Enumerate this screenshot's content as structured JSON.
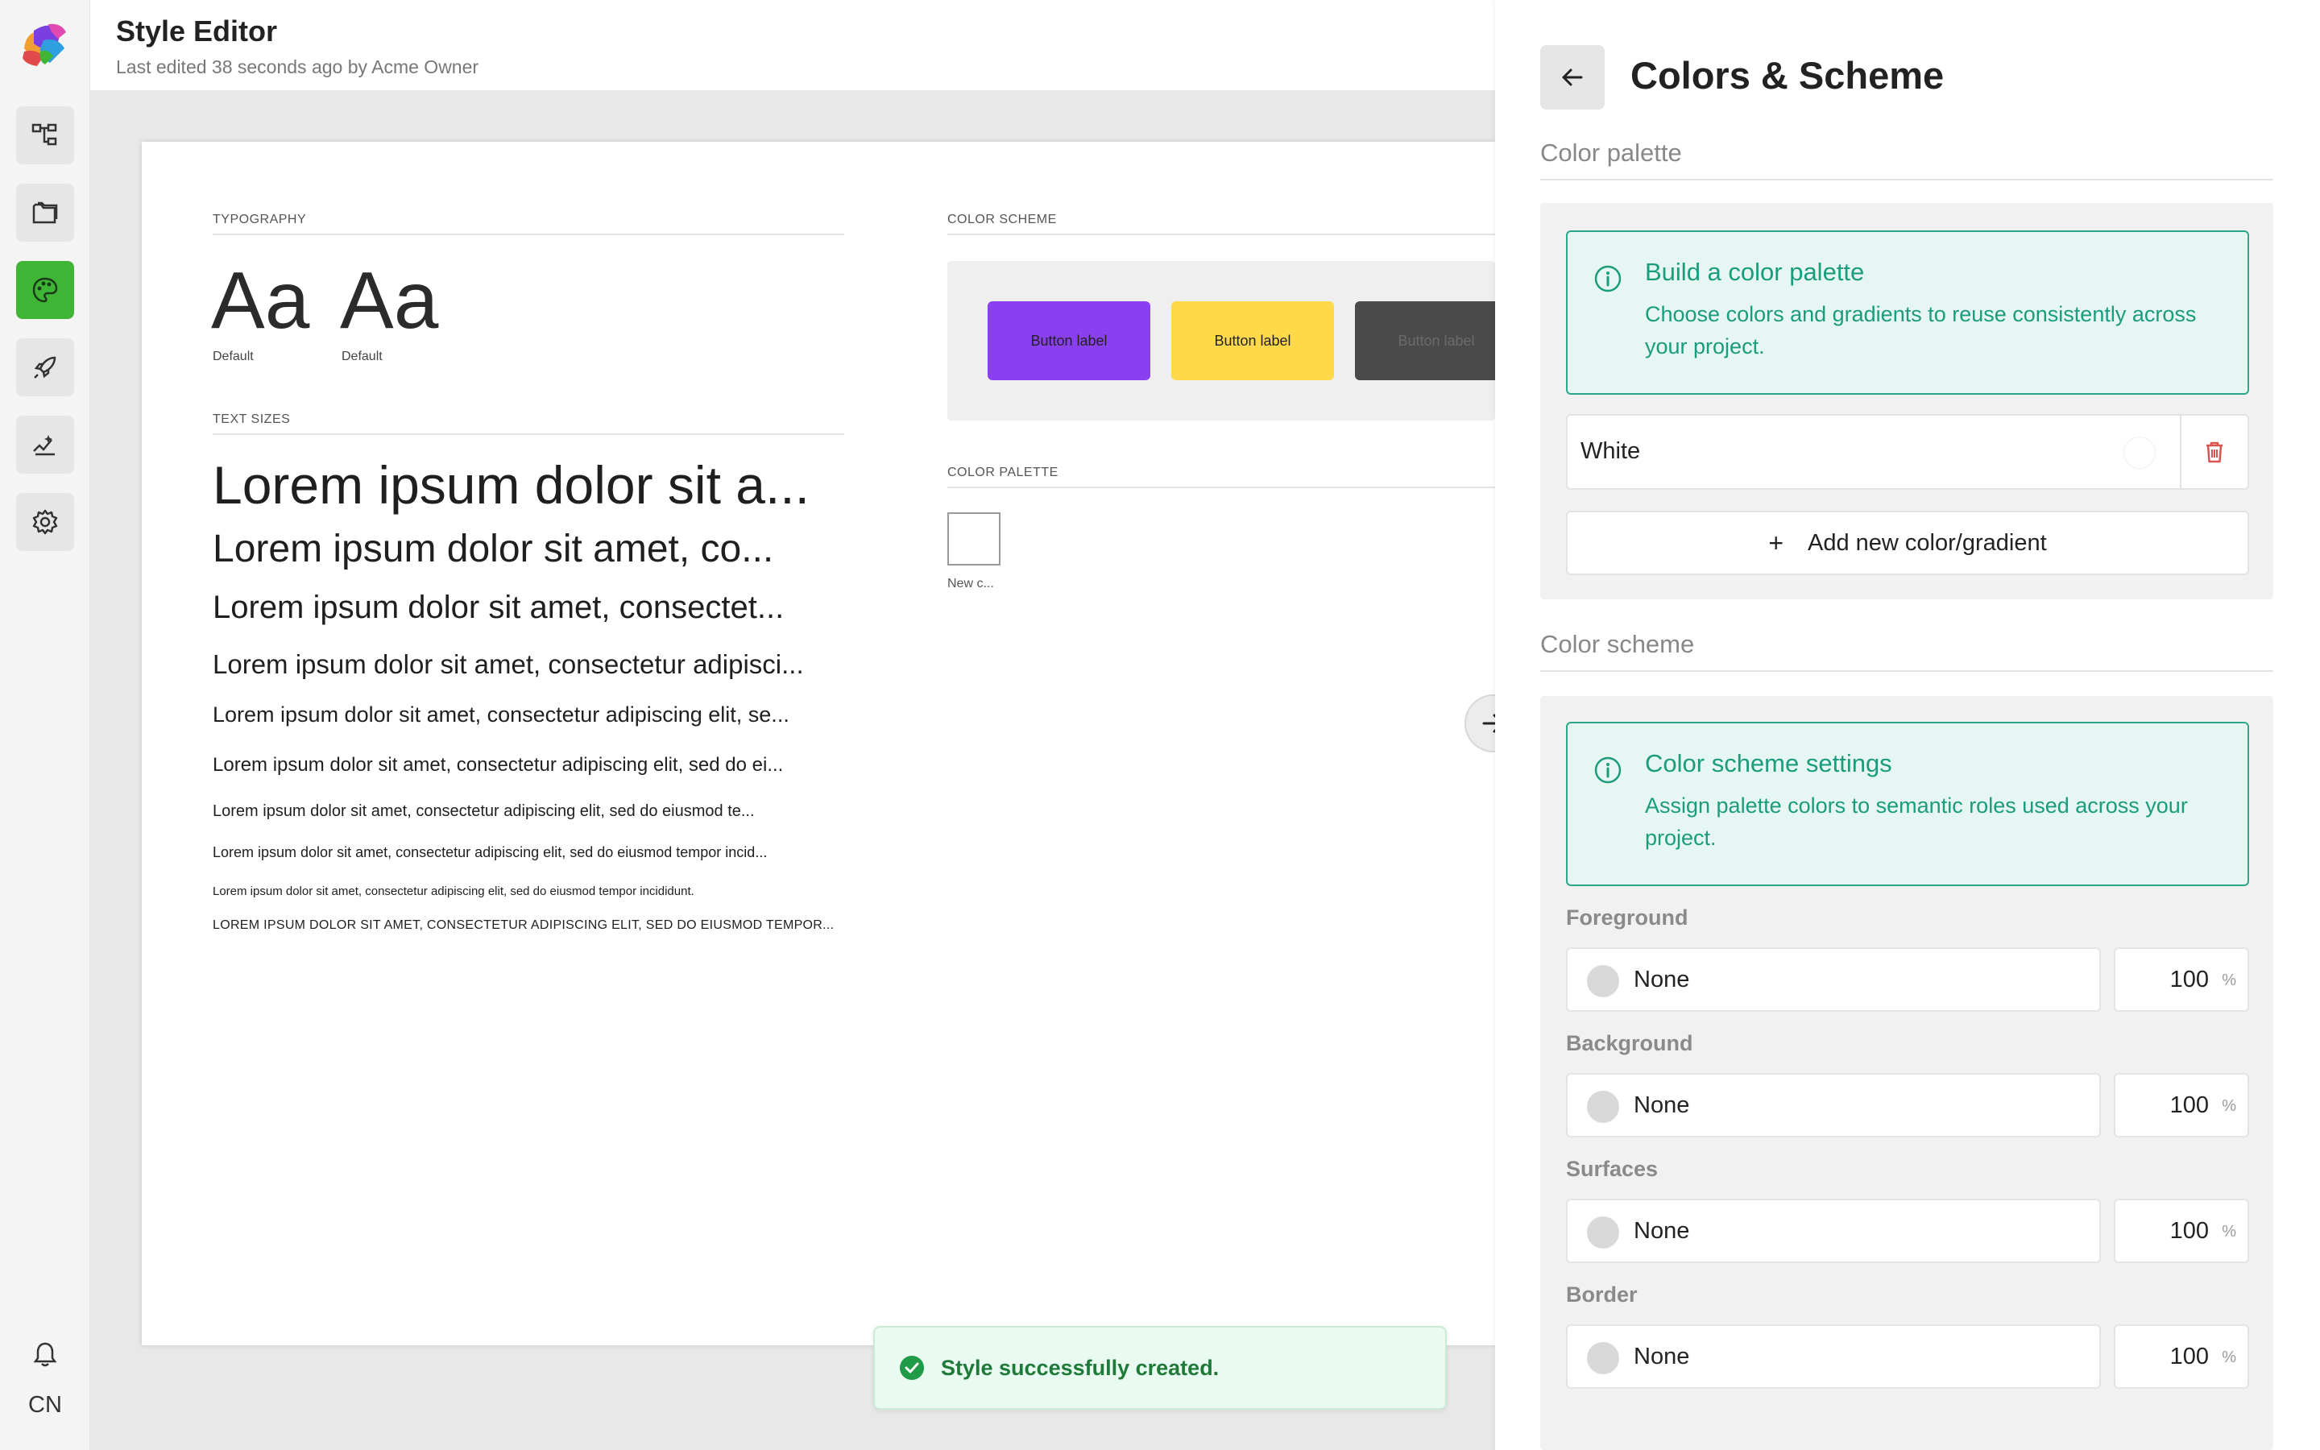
{
  "header": {
    "title": "Style Editor",
    "subtitle": "Last edited 38 seconds ago by Acme Owner"
  },
  "sidebar": {
    "items": [
      {
        "icon": "sitemap-icon"
      },
      {
        "icon": "pages-icon"
      },
      {
        "icon": "palette-icon",
        "active": true
      },
      {
        "icon": "rocket-icon"
      },
      {
        "icon": "analytics-icon"
      },
      {
        "icon": "gear-icon"
      }
    ],
    "user_initials": "CN"
  },
  "canvas": {
    "typography_label": "TYPOGRAPHY",
    "font_samples": [
      {
        "glyph": "Aa",
        "label": "Default"
      },
      {
        "glyph": "Aa",
        "label": "Default"
      }
    ],
    "text_sizes_label": "TEXT SIZES",
    "text_samples": [
      "Lorem ipsum dolor sit a...",
      "Lorem ipsum dolor sit amet, co...",
      "Lorem ipsum dolor sit amet, consectet...",
      "Lorem ipsum dolor sit amet, consectetur adipisci...",
      "Lorem ipsum dolor sit amet, consectetur adipiscing elit, se...",
      "Lorem ipsum dolor sit amet, consectetur adipiscing elit, sed do ei...",
      "Lorem ipsum dolor sit amet, consectetur adipiscing elit, sed do eiusmod te...",
      "Lorem ipsum dolor sit amet, consectetur adipiscing elit, sed do eiusmod tempor incid...",
      "Lorem ipsum dolor sit amet, consectetur adipiscing elit, sed do eiusmod tempor incididunt.",
      "LOREM IPSUM DOLOR SIT AMET, CONSECTETUR ADIPISCING ELIT, SED DO EIUSMOD TEMPOR..."
    ],
    "color_scheme_label": "COLOR SCHEME",
    "scheme_buttons": [
      {
        "label": "Button label",
        "bg": "#8a3ff0",
        "fg": "#222222"
      },
      {
        "label": "Button label",
        "bg": "#ffd94a",
        "fg": "#222222"
      },
      {
        "label": "Button label",
        "bg": "#4a4a4a",
        "fg": "#6b6b6b"
      }
    ],
    "color_palette_label": "COLOR PALETTE",
    "palette_swatch_label": "New c..."
  },
  "toast": {
    "message": "Style successfully created."
  },
  "panel": {
    "title": "Colors & Scheme",
    "palette_heading": "Color palette",
    "palette_info_title": "Build a color palette",
    "palette_info_text": "Choose colors and gradients to reuse consistently across your project.",
    "palette_colors": [
      {
        "name": "White",
        "color": "#ffffff"
      }
    ],
    "add_color_label": "Add new color/gradient",
    "scheme_heading": "Color scheme",
    "scheme_info_title": "Color scheme settings",
    "scheme_info_text": "Assign palette colors to semantic roles used across your project.",
    "roles": [
      {
        "label": "Foreground",
        "value": "None",
        "opacity": "100",
        "unit": "%"
      },
      {
        "label": "Background",
        "value": "None",
        "opacity": "100",
        "unit": "%"
      },
      {
        "label": "Surfaces",
        "value": "None",
        "opacity": "100",
        "unit": "%"
      },
      {
        "label": "Border",
        "value": "None",
        "opacity": "100",
        "unit": "%"
      }
    ]
  },
  "colors": {
    "accent_green": "#3fb536",
    "info_teal": "#1a9c7d",
    "delete_red": "#d9534f"
  }
}
